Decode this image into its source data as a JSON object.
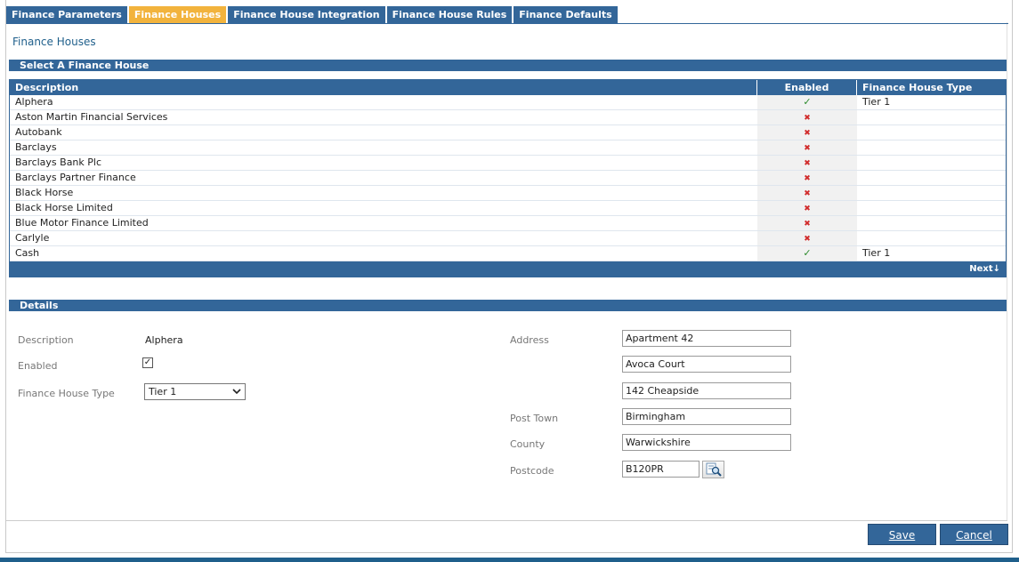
{
  "tabs": [
    {
      "label": "Finance Parameters",
      "active": false
    },
    {
      "label": "Finance Houses",
      "active": true
    },
    {
      "label": "Finance House Integration",
      "active": false
    },
    {
      "label": "Finance House Rules",
      "active": false
    },
    {
      "label": "Finance Defaults",
      "active": false
    }
  ],
  "page_title": "Finance Houses",
  "select_section": "Select A Finance House",
  "grid": {
    "headers": {
      "description": "Description",
      "enabled": "Enabled",
      "type": "Finance House Type"
    },
    "rows": [
      {
        "description": "Alphera",
        "enabled": true,
        "type": "Tier 1"
      },
      {
        "description": "Aston Martin Financial Services",
        "enabled": false,
        "type": ""
      },
      {
        "description": "Autobank",
        "enabled": false,
        "type": ""
      },
      {
        "description": "Barclays",
        "enabled": false,
        "type": ""
      },
      {
        "description": "Barclays Bank Plc",
        "enabled": false,
        "type": ""
      },
      {
        "description": "Barclays Partner Finance",
        "enabled": false,
        "type": ""
      },
      {
        "description": "Black Horse",
        "enabled": false,
        "type": ""
      },
      {
        "description": "Black Horse Limited",
        "enabled": false,
        "type": ""
      },
      {
        "description": "Blue Motor Finance Limited",
        "enabled": false,
        "type": ""
      },
      {
        "description": "Carlyle",
        "enabled": false,
        "type": ""
      },
      {
        "description": "Cash",
        "enabled": true,
        "type": "Tier 1"
      }
    ],
    "next_label": "Next"
  },
  "details_section": "Details",
  "details": {
    "description_label": "Description",
    "description_value": "Alphera",
    "enabled_label": "Enabled",
    "enabled_value": true,
    "type_label": "Finance House Type",
    "type_value": "Tier 1",
    "address_label": "Address",
    "address_1": "Apartment 42",
    "address_2": "Avoca Court",
    "address_3": "142 Cheapside",
    "post_town_label": "Post Town",
    "post_town": "Birmingham",
    "county_label": "County",
    "county": "Warwickshire",
    "postcode_label": "Postcode",
    "postcode": "B120PR"
  },
  "buttons": {
    "save": "Save",
    "cancel": "Cancel"
  },
  "colors": {
    "header": "#336699",
    "active_tab": "#f2b33d",
    "check": "#2e8b2e",
    "cross": "#d12b2b"
  }
}
